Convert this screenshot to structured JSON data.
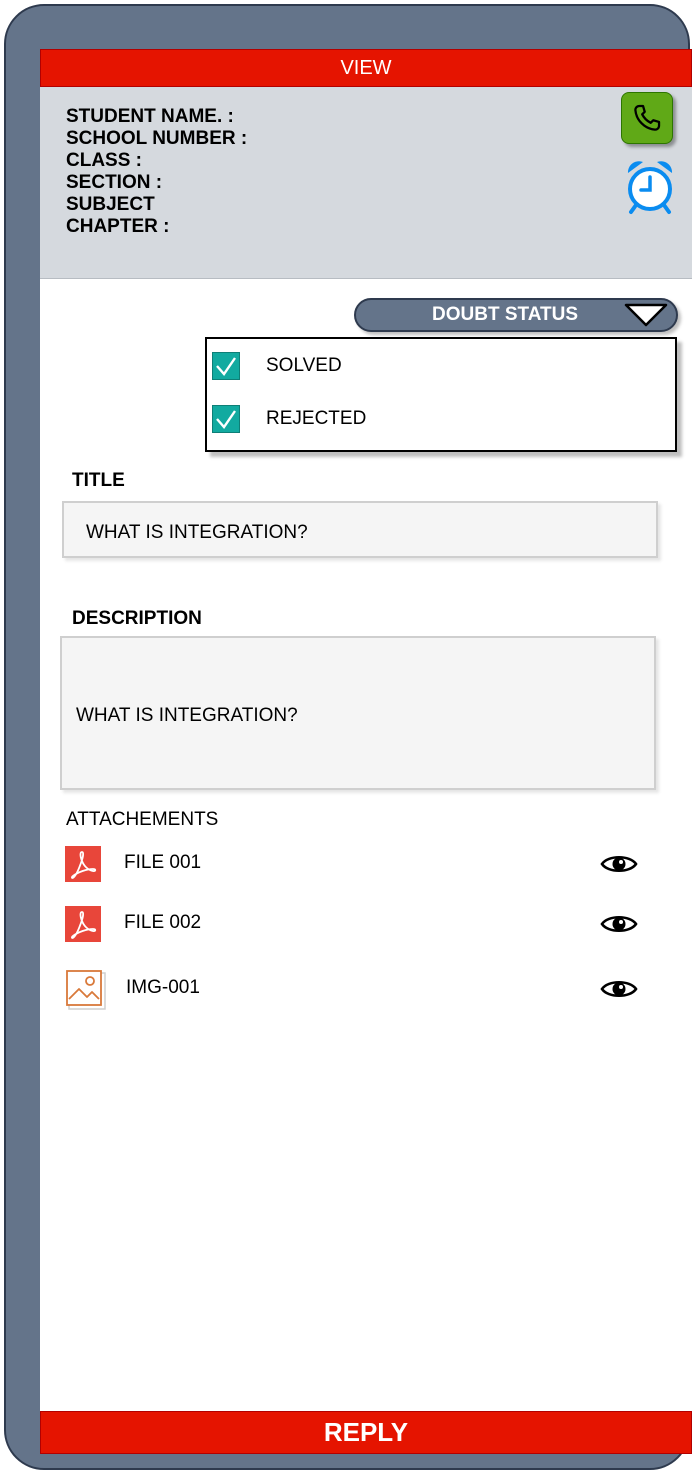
{
  "header": {
    "title": "VIEW"
  },
  "student_info": {
    "lines": [
      "STUDENT NAME. :",
      "SCHOOL NUMBER :",
      "CLASS :",
      "SECTION :",
      "SUBJECT",
      "CHAPTER :"
    ]
  },
  "icons": {
    "call": "phone-icon",
    "alarm": "alarm-clock-icon",
    "dropdown": "caret-down-icon",
    "check": "checkmark-icon",
    "pdf": "pdf-file-icon",
    "image": "image-file-icon",
    "view": "eye-icon"
  },
  "doubt_status": {
    "label": "DOUBT STATUS",
    "options": [
      {
        "label": "SOLVED",
        "checked": true
      },
      {
        "label": "REJECTED",
        "checked": true
      }
    ]
  },
  "title_field": {
    "label": "TITLE",
    "value": "WHAT IS INTEGRATION?"
  },
  "description_field": {
    "label": "DESCRIPTION",
    "value": "WHAT IS INTEGRATION?"
  },
  "attachments": {
    "heading": "ATTACHEMENTS",
    "items": [
      {
        "name": "FILE 001",
        "type": "pdf"
      },
      {
        "name": "FILE 002",
        "type": "pdf"
      },
      {
        "name": "IMG-001",
        "type": "image"
      }
    ]
  },
  "footer": {
    "reply_label": "REPLY"
  },
  "colors": {
    "frame": "#64748a",
    "accent_red": "#e51400",
    "call_green": "#60a917",
    "alarm_blue": "#0a8cf0",
    "check_teal": "#12aaa0",
    "pdf_red": "#e8463a",
    "image_orange": "#d9793a"
  }
}
